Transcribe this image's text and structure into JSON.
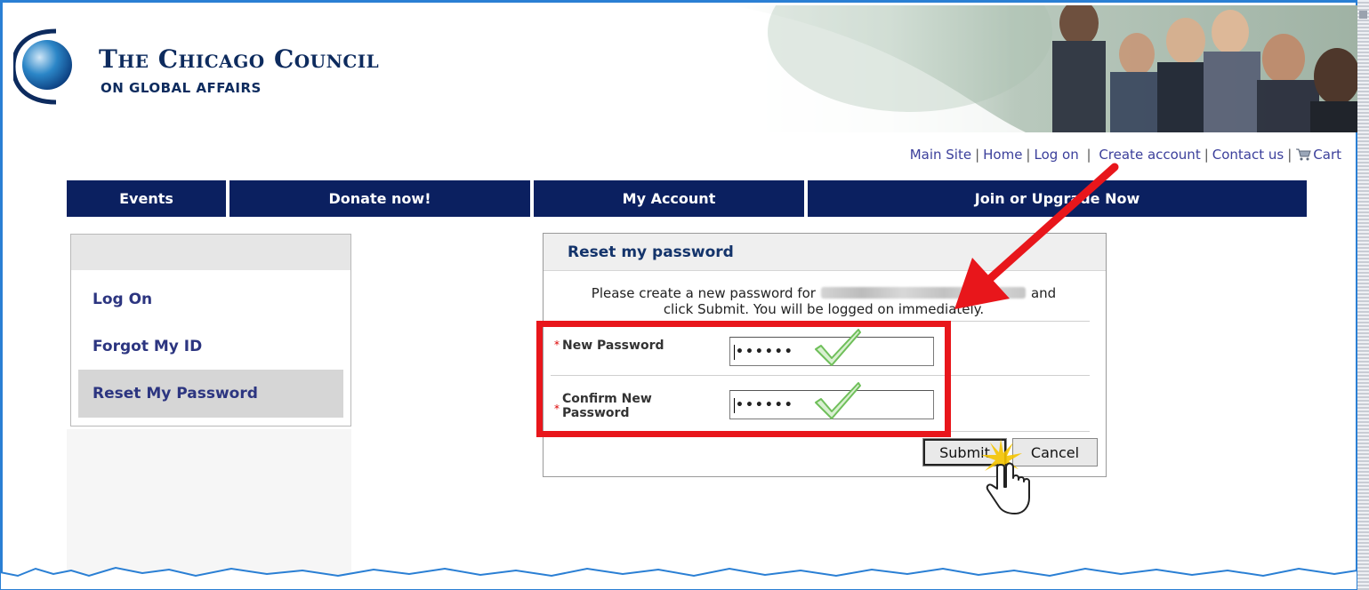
{
  "brand": {
    "title": "The Chicago Council",
    "subtitle": "ON GLOBAL AFFAIRS"
  },
  "toplinks": {
    "items": [
      "Main Site",
      "Home",
      "Log on",
      "Create account",
      "Contact us",
      "Cart"
    ]
  },
  "nav": {
    "items": [
      "Events",
      "Donate now!",
      "My Account",
      "Join or Upgrade Now"
    ]
  },
  "sidebar": {
    "items": [
      {
        "label": "Log On",
        "active": false
      },
      {
        "label": "Forgot My ID",
        "active": false
      },
      {
        "label": "Reset My Password",
        "active": true
      }
    ]
  },
  "panel": {
    "title": "Reset my password",
    "instruction_before": "Please create a new password for",
    "instruction_after": "and",
    "instruction_line2": "click Submit. You will be logged on immediately.",
    "fields": {
      "new_password": {
        "label": "New Password",
        "value": "••••••",
        "required_mark": "*"
      },
      "confirm_password": {
        "label_line1": "Confirm New",
        "label_line2": "Password",
        "value": "••••••",
        "required_mark": "*"
      }
    },
    "buttons": {
      "submit": "Submit",
      "cancel": "Cancel"
    }
  },
  "colors": {
    "nav_bg": "#0b2060",
    "link": "#3b3f9b",
    "highlight_red": "#e8161b",
    "check_green": "#6fbf5a"
  },
  "icons": [
    "cart-icon",
    "checkmark-icon",
    "arrow-annotation",
    "hand-cursor-icon",
    "globe-logo-icon"
  ]
}
